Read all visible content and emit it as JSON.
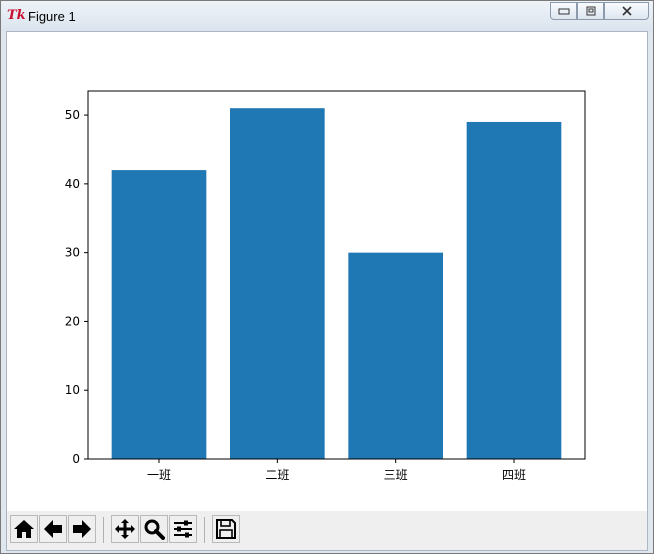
{
  "window": {
    "title": "Figure 1",
    "app_icon_text": "Tk"
  },
  "colors": {
    "bar": "#1f77b4",
    "axis": "#000000",
    "toolbar_bg": "#efefef"
  },
  "toolbar": {
    "buttons": [
      {
        "icon": "home-icon"
      },
      {
        "icon": "back-arrow-icon"
      },
      {
        "icon": "forward-arrow-icon"
      },
      {
        "icon": "pan-icon"
      },
      {
        "icon": "zoom-icon"
      },
      {
        "icon": "configure-subplots-icon"
      },
      {
        "icon": "save-icon"
      }
    ]
  },
  "chart_data": {
    "type": "bar",
    "categories": [
      "一班",
      "二班",
      "三班",
      "四班"
    ],
    "values": [
      42,
      51,
      30,
      49
    ],
    "ylim": [
      0,
      53.5
    ],
    "yticks": [
      0,
      10,
      20,
      30,
      40,
      50
    ],
    "grid": false
  }
}
